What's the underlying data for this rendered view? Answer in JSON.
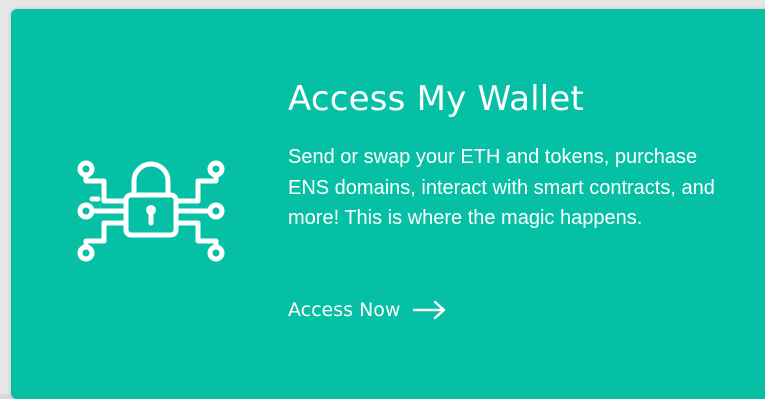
{
  "card": {
    "title": "Access My Wallet",
    "description": "Send or swap your ETH and tokens, purchase ENS domains, interact with smart contracts, and more! This is where the magic happens.",
    "cta_label": "Access Now",
    "background_color": "#05c0a5",
    "text_color": "#ffffff"
  },
  "icons": {
    "main": "circuit-padlock-icon",
    "cta": "arrow-right-icon"
  }
}
